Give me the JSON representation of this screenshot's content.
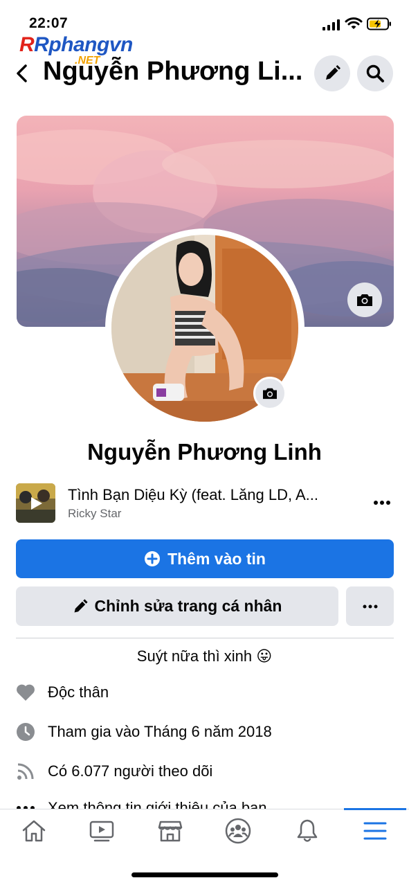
{
  "status_bar": {
    "time": "22:07"
  },
  "watermark": {
    "brand": "Rphangvn",
    "suffix": ".NET"
  },
  "header": {
    "title": "Nguyễn Phương Li..."
  },
  "profile": {
    "name": "Nguyễn Phương Linh"
  },
  "music": {
    "song": "Tình Bạn Diệu Kỳ (feat. Lăng LD, A...",
    "artist": "Ricky Star"
  },
  "actions": {
    "add_story_label": "Thêm vào tin",
    "edit_profile_label": "Chỉnh sửa trang cá nhân"
  },
  "bio": "Suýt nữa thì xinh 😛",
  "details": [
    {
      "icon": "heart-icon",
      "text": "Độc thân"
    },
    {
      "icon": "clock-icon",
      "text": "Tham gia vào Tháng 6 năm 2018"
    },
    {
      "icon": "rss-icon",
      "text": "Có 6.077 người theo dõi"
    },
    {
      "icon": "more-dots-icon",
      "text": "Xem thông tin giới thiệu của bạn"
    }
  ],
  "tabbar": {
    "tabs": [
      "home-icon",
      "watch-icon",
      "marketplace-icon",
      "groups-icon",
      "notifications-icon",
      "menu-icon"
    ],
    "active": "menu-icon"
  },
  "colors": {
    "accent": "#1b74e4",
    "button_gray": "#e4e6eb",
    "secondary_text": "#65676b"
  }
}
